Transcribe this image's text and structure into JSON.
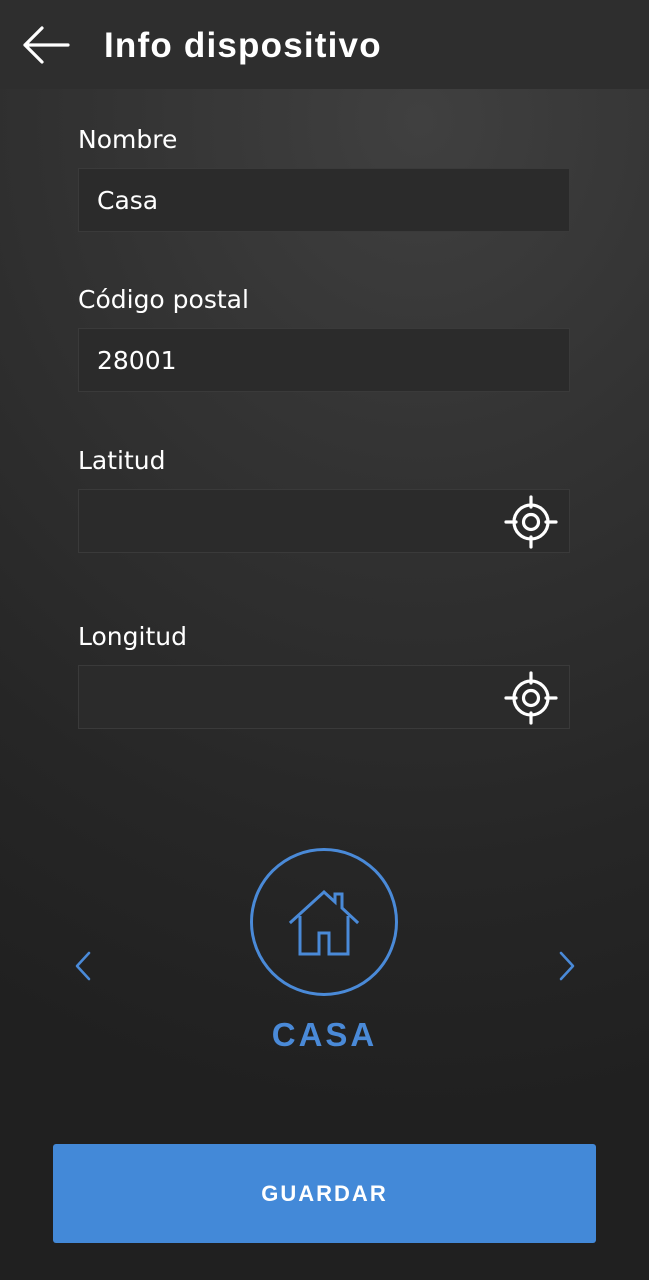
{
  "appbar": {
    "title": "Info dispositivo",
    "back_icon": "arrow-left-icon"
  },
  "form": {
    "nombre": {
      "label": "Nombre",
      "value": "Casa",
      "placeholder": ""
    },
    "codigo_postal": {
      "label": "Código postal",
      "value": "28001",
      "placeholder": ""
    },
    "latitud": {
      "label": "Latitud",
      "value": "",
      "placeholder": "",
      "icon": "crosshair-locate-icon"
    },
    "longitud": {
      "label": "Longitud",
      "value": "",
      "placeholder": "",
      "icon": "crosshair-locate-icon"
    }
  },
  "device_type": {
    "selected_label": "CASA",
    "icon": "house-icon",
    "prev_icon": "chevron-left-icon",
    "next_icon": "chevron-right-icon"
  },
  "actions": {
    "save_label": "GUARDAR"
  },
  "colors": {
    "accent": "#4389d8",
    "appbar": "#2e2e2e",
    "field_bg": "#2b2b2b",
    "text": "#ffffff"
  }
}
